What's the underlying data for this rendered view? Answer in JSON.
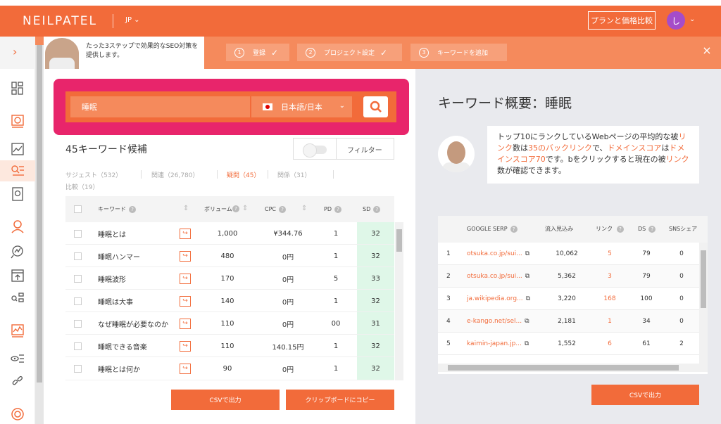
{
  "header": {
    "logo": "NEILPATEL",
    "lang": "JP",
    "pricing_label": "プランと価格比較",
    "avatar_initial": "し"
  },
  "onboarding": {
    "text": "たった3ステップで効果的なSEO対策を提供します。",
    "steps": [
      {
        "num": "1",
        "label": "登録",
        "check": "✓"
      },
      {
        "num": "2",
        "label": "プロジェクト設定",
        "check": "✓"
      },
      {
        "num": "3",
        "label": "キーワードを追加",
        "check": ""
      }
    ]
  },
  "search": {
    "term": "睡眠",
    "language": "日本語/日本"
  },
  "keywords": {
    "count_label": "45キーワード候補",
    "filter_label": "フィルター",
    "tabs": [
      {
        "label": "サジェスト（532）",
        "active": false
      },
      {
        "label": "関連（26,780）",
        "active": false
      },
      {
        "label": "疑問（45）",
        "active": true
      },
      {
        "label": "関係（31）",
        "active": false
      },
      {
        "label": "比較（19）",
        "active": false
      }
    ],
    "columns": {
      "keyword": "キーワード",
      "volume": "ボリューム",
      "cpc": "CPC",
      "pd": "PD",
      "sd": "SD"
    },
    "rows": [
      {
        "keyword": "睡眠とは",
        "volume": "1,000",
        "cpc": "¥344.76",
        "pd": "1",
        "sd": "32"
      },
      {
        "keyword": "睡眠ハンマー",
        "volume": "480",
        "cpc": "0円",
        "pd": "1",
        "sd": "32"
      },
      {
        "keyword": "睡眠波形",
        "volume": "170",
        "cpc": "0円",
        "pd": "5",
        "sd": "33"
      },
      {
        "keyword": "睡眠は大事",
        "volume": "140",
        "cpc": "0円",
        "pd": "1",
        "sd": "32"
      },
      {
        "keyword": "なぜ睡眠が必要なのか",
        "volume": "110",
        "cpc": "0円",
        "pd": "00",
        "sd": "31"
      },
      {
        "keyword": "睡眠できる音楽",
        "volume": "110",
        "cpc": "140.15円",
        "pd": "1",
        "sd": "32"
      },
      {
        "keyword": "睡眠とは何か",
        "volume": "90",
        "cpc": "0円",
        "pd": "1",
        "sd": "32"
      }
    ],
    "csv_button": "CSVで出力",
    "clipboard_button": "クリップボードにコピー"
  },
  "overview": {
    "title": "キーワード概要：睡眠",
    "bubble": {
      "p1": "トップ10にランクしているWebページの平均的な被",
      "h1": "リンク",
      "p2": "数は",
      "h2": "35のバックリンク",
      "p3": "で、",
      "h3": "ドメインスコア",
      "p4": "は",
      "h4": "ドメインスコア70",
      "p5": "です。bをクリックすると現在の被",
      "h5": "リンク",
      "p6": "数が確認できます。"
    },
    "columns": {
      "serp": "GOOGLE SERP",
      "traffic": "流入見込み",
      "links": "リンク",
      "ds": "DS",
      "social": "SNSシェア"
    },
    "rows": [
      {
        "n": "1",
        "url": "otsuka.co.jp/sui...",
        "traffic": "10,062",
        "links": "5",
        "ds": "79",
        "social": "0"
      },
      {
        "n": "2",
        "url": "otsuka.co.jp/sui...",
        "traffic": "5,362",
        "links": "3",
        "ds": "79",
        "social": "0"
      },
      {
        "n": "3",
        "url": "ja.wikipedia.org...",
        "traffic": "3,220",
        "links": "168",
        "ds": "100",
        "social": "0"
      },
      {
        "n": "4",
        "url": "e-kango.net/sel...",
        "traffic": "2,181",
        "links": "1",
        "ds": "34",
        "social": "0"
      },
      {
        "n": "5",
        "url": "kaimin-japan.jp...",
        "traffic": "1,552",
        "links": "6",
        "ds": "61",
        "social": "2"
      }
    ],
    "csv_button": "CSVで出力"
  },
  "colors": {
    "brand": "#f26b3a",
    "search_frame": "#e8256b",
    "sd_green": "#dff7e8"
  }
}
